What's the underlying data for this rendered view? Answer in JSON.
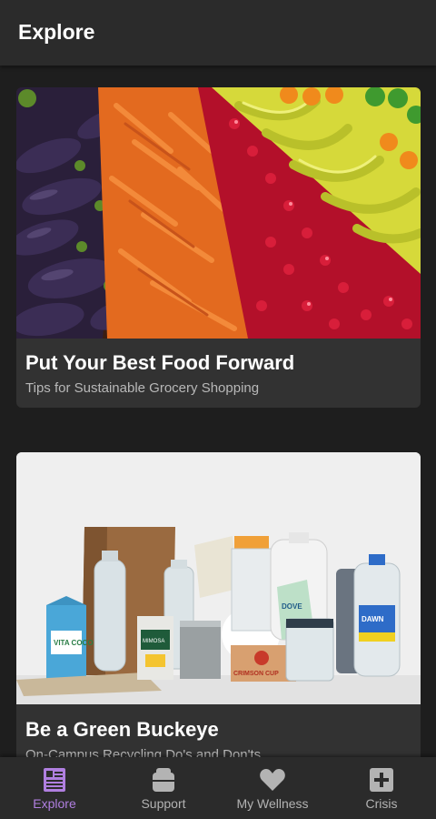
{
  "header": {
    "title": "Explore"
  },
  "cards": [
    {
      "title": "Put Your Best Food Forward",
      "subtitle": "Tips for Sustainable Grocery Shopping",
      "image": "produce-photo"
    },
    {
      "title": "Be a Green Buckeye",
      "subtitle": "On-Campus Recycling Do's and Don'ts",
      "image": "recyclables-photo",
      "image_labels": [
        "VITA COCO",
        "MIMOSA",
        "DOVE",
        "DAWN",
        "CRIMSON CUP"
      ]
    }
  ],
  "nav": {
    "items": [
      {
        "label": "Explore",
        "icon": "article-icon",
        "active": true
      },
      {
        "label": "Support",
        "icon": "support-icon",
        "active": false
      },
      {
        "label": "My Wellness",
        "icon": "heart-icon",
        "active": false
      },
      {
        "label": "Crisis",
        "icon": "plus-box-icon",
        "active": false
      }
    ]
  },
  "colors": {
    "background": "#1e1e1e",
    "bar": "#2b2b2b",
    "card": "#323232",
    "accent": "#b07fe0",
    "inactive": "#b3b3b3"
  }
}
